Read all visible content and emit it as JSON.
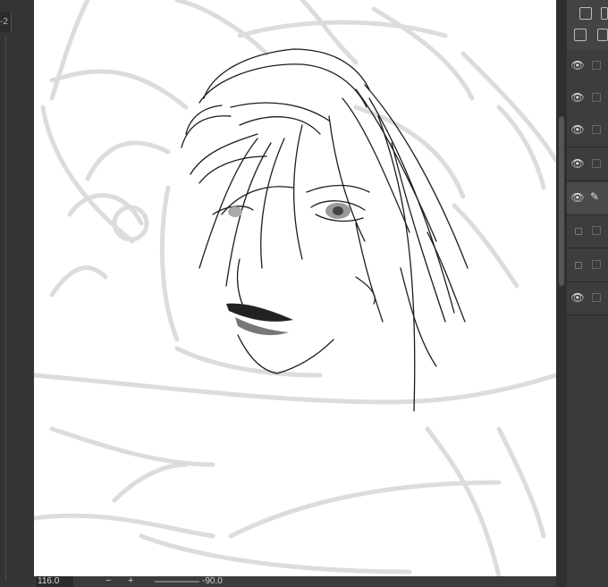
{
  "left_panel": {
    "tab_label": "-2"
  },
  "status_bar": {
    "zoom_value": "116.0",
    "zoom_out": "−",
    "zoom_in": "+",
    "angle_value": "-90.0"
  },
  "layers": {
    "rows": [
      {
        "visible": true,
        "editing": false
      },
      {
        "visible": true,
        "editing": false
      },
      {
        "visible": true,
        "editing": false
      },
      {
        "visible": true,
        "editing": false
      },
      {
        "visible": true,
        "editing": true
      },
      {
        "visible": false,
        "editing": false
      },
      {
        "visible": false,
        "editing": false
      },
      {
        "visible": true,
        "editing": false
      }
    ]
  },
  "icons": {
    "eye": "👁",
    "pen": "✎"
  }
}
